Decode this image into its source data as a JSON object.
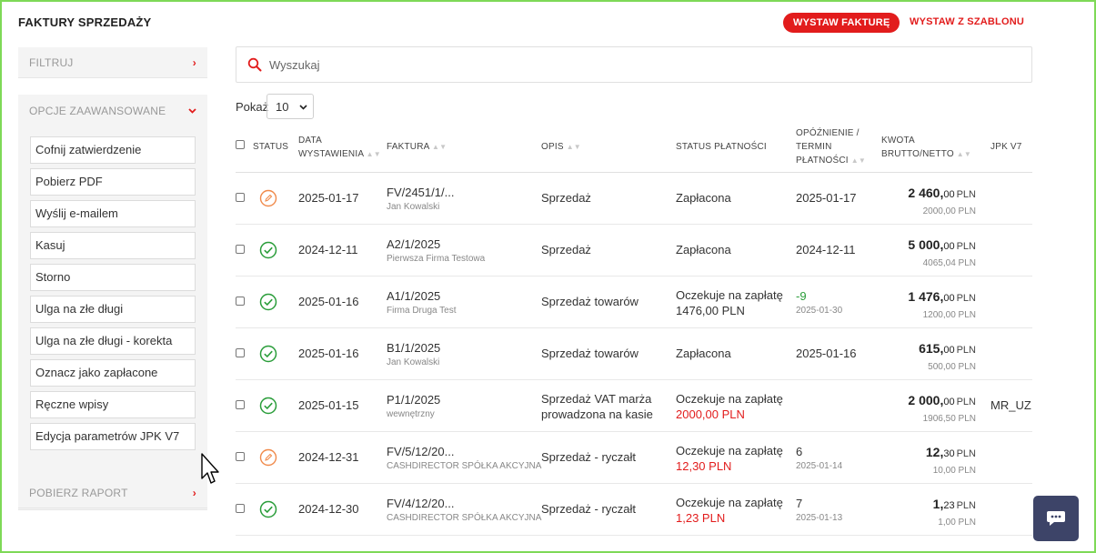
{
  "header": {
    "title": "FAKTURY SPRZEDAŻY",
    "issue_invoice": "WYSTAW FAKTURĘ",
    "issue_from_template": "WYSTAW Z SZABLONU"
  },
  "sidebar": {
    "filter_label": "FILTRUJ",
    "advanced_label": "OPCJE ZAAWANSOWANE",
    "options": [
      "Cofnij zatwierdzenie",
      "Pobierz PDF",
      "Wyślij e-mailem",
      "Kasuj",
      "Storno",
      "Ulga na złe długi",
      "Ulga na złe długi - korekta",
      "Oznacz jako zapłacone",
      "Ręczne wpisy",
      "Edycja parametrów JPK V7"
    ],
    "report_label": "POBIERZ RAPORT"
  },
  "search": {
    "placeholder": "Wyszukaj"
  },
  "pager": {
    "label": "Pokaż",
    "value": "10"
  },
  "table": {
    "headers": {
      "status": "STATUS",
      "date_1": "DATA",
      "date_2": "WYSTAWIENIA",
      "invoice": "FAKTURA",
      "desc": "OPIS",
      "payment": "STATUS PŁATNOŚCI",
      "delay_1": "OPÓŹNIENIE /",
      "delay_2": "TERMIN",
      "delay_3": "PŁATNOŚCI",
      "amount_1": "KWOTA",
      "amount_2": "BRUTTO/NETTO",
      "jpk": "JPK V7"
    },
    "rows": [
      {
        "status": "draft",
        "date": "2025-01-17",
        "invoice": "FV/2451/1/...",
        "client": "Jan Kowalski",
        "desc_1": "Sprzedaż",
        "desc_2": "",
        "payment_1": "Zapłacona",
        "payment_2": "",
        "delay": "",
        "due": "2025-01-17",
        "gross_int": "2 460,",
        "gross_dec": "00",
        "currency": "PLN",
        "net": "2000,00 PLN",
        "jpk": ""
      },
      {
        "status": "approved",
        "date": "2024-12-11",
        "invoice": "A2/1/2025",
        "client": "Pierwsza Firma Testowa",
        "desc_1": "Sprzedaż",
        "desc_2": "",
        "payment_1": "Zapłacona",
        "payment_2": "",
        "delay": "",
        "due": "2024-12-11",
        "gross_int": "5 000,",
        "gross_dec": "00",
        "currency": "PLN",
        "net": "4065,04 PLN",
        "jpk": ""
      },
      {
        "status": "approved",
        "date": "2025-01-16",
        "invoice": "A1/1/2025",
        "client": "Firma Druga Test",
        "desc_1": "Sprzedaż towarów",
        "desc_2": "",
        "payment_1": "Oczekuje na zapłatę",
        "payment_2": "1476,00 PLN",
        "delay": "-9",
        "due": "2025-01-30",
        "gross_int": "1 476,",
        "gross_dec": "00",
        "currency": "PLN",
        "net": "1200,00 PLN",
        "jpk": ""
      },
      {
        "status": "approved",
        "date": "2025-01-16",
        "invoice": "B1/1/2025",
        "client": "Jan Kowalski",
        "desc_1": "Sprzedaż towarów",
        "desc_2": "",
        "payment_1": "Zapłacona",
        "payment_2": "",
        "delay": "",
        "due": "2025-01-16",
        "gross_int": "615,",
        "gross_dec": "00",
        "currency": "PLN",
        "net": "500,00 PLN",
        "jpk": ""
      },
      {
        "status": "approved",
        "date": "2025-01-15",
        "invoice": "P1/1/2025",
        "client": "wewnętrzny",
        "desc_1": "Sprzedaż VAT marża",
        "desc_2": "prowadzona na kasie",
        "payment_1": "Oczekuje na zapłatę",
        "payment_2": "2000,00 PLN",
        "delay": "",
        "due": "",
        "gross_int": "2 000,",
        "gross_dec": "00",
        "currency": "PLN",
        "net": "1906,50 PLN",
        "jpk": "MR_UZ"
      },
      {
        "status": "draft",
        "date": "2024-12-31",
        "invoice": "FV/5/12/20...",
        "client": "CASHDIRECTOR SPÓŁKA AKCYJNA",
        "desc_1": "Sprzedaż - ryczałt",
        "desc_2": "",
        "payment_1": "Oczekuje na zapłatę",
        "payment_2": "12,30 PLN",
        "delay": "6",
        "due": "2025-01-14",
        "gross_int": "12,",
        "gross_dec": "30",
        "currency": "PLN",
        "net": "10,00 PLN",
        "jpk": ""
      },
      {
        "status": "approved",
        "date": "2024-12-30",
        "invoice": "FV/4/12/20...",
        "client": "CASHDIRECTOR SPÓŁKA AKCYJNA",
        "desc_1": "Sprzedaż - ryczałt",
        "desc_2": "",
        "payment_1": "Oczekuje na zapłatę",
        "payment_2": "1,23 PLN",
        "delay": "7",
        "due": "2025-01-13",
        "gross_int": "1,",
        "gross_dec": "23",
        "currency": "PLN",
        "net": "1,00 PLN",
        "jpk": ""
      }
    ]
  },
  "colors": {
    "accent": "#e21c1c",
    "success": "#2a9d3a",
    "draft": "#f08a4b",
    "chat": "#3d4468"
  }
}
